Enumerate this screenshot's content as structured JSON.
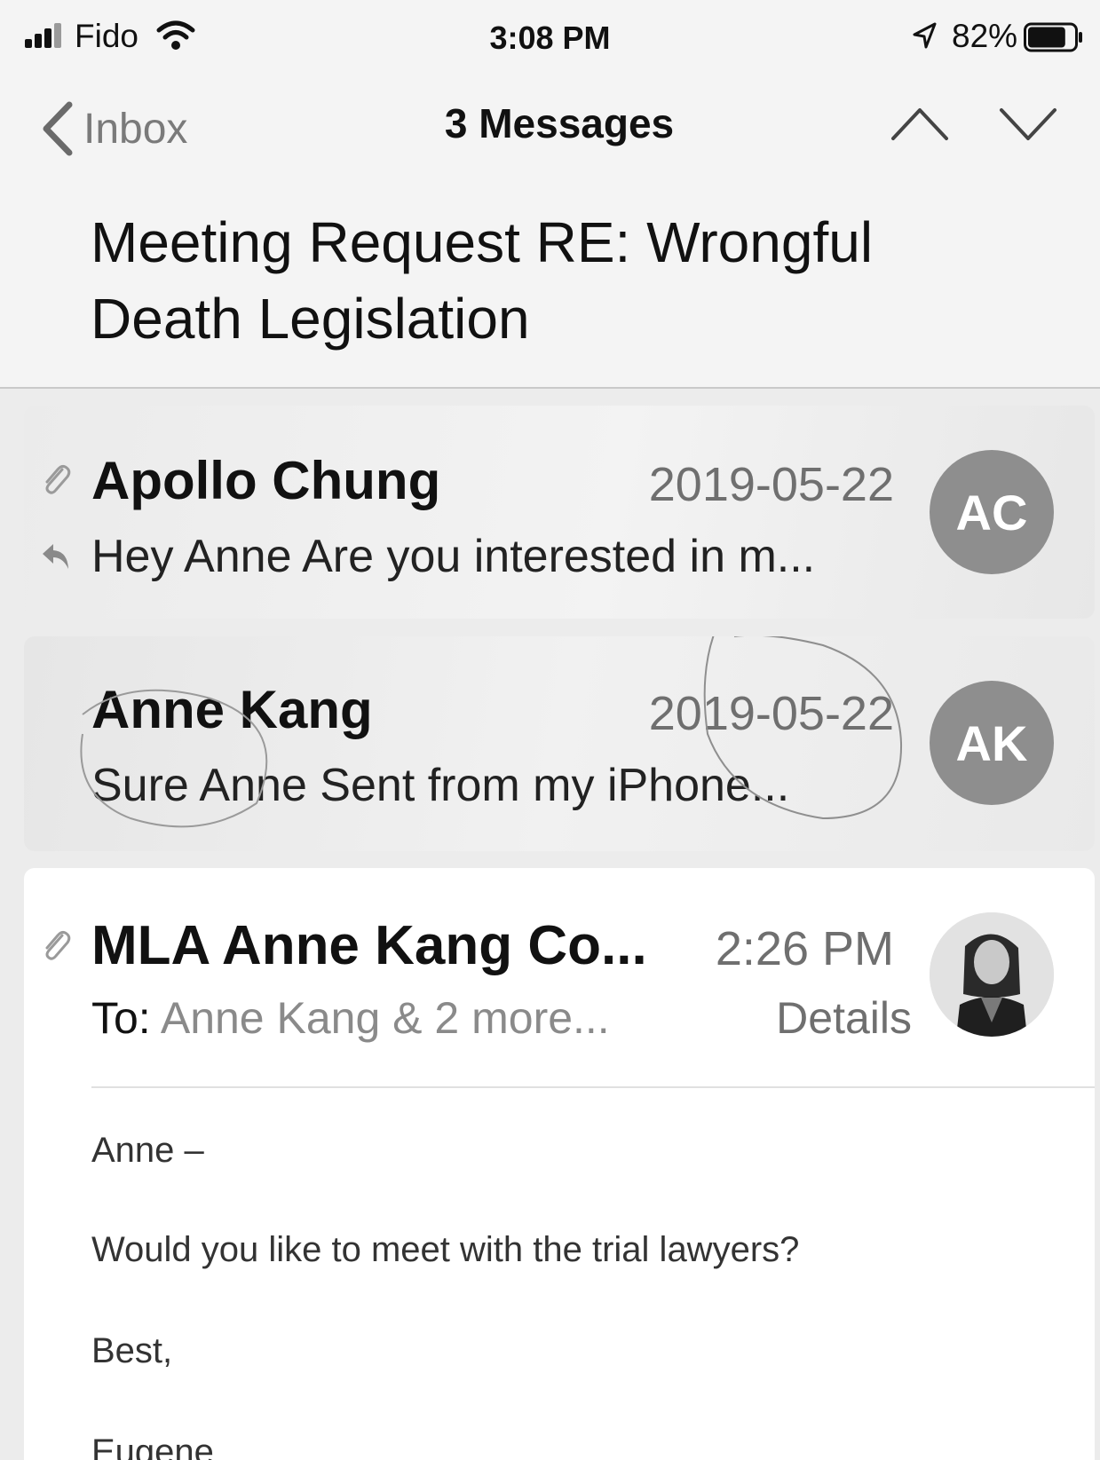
{
  "status_bar": {
    "carrier": "Fido",
    "time": "3:08 PM",
    "battery_percent": "82%",
    "battery_level": 0.82,
    "icons": [
      "signal-icon",
      "wifi-icon",
      "location-arrow-icon",
      "battery-icon"
    ]
  },
  "nav": {
    "back_label": "Inbox",
    "title": "3 Messages",
    "icons": [
      "back-chevron-icon",
      "chevron-up-icon",
      "chevron-down-icon"
    ]
  },
  "subject": "Meeting Request RE: Wrongful Death Legislation",
  "messages": [
    {
      "sender": "Apollo Chung",
      "date": "2019-05-22",
      "preview": "Hey Anne Are you interested in m...",
      "avatar_initials": "AC",
      "icons": [
        "paperclip-icon",
        "reply-icon"
      ]
    },
    {
      "sender": "Anne Kang",
      "date": "2019-05-22",
      "preview": "Sure Anne Sent from my iPhone...",
      "avatar_initials": "AK"
    },
    {
      "sender": "MLA Anne Kang Co...",
      "date": "2:26 PM",
      "to_label": "To:",
      "to_recipients": "Anne Kang & 2 more...",
      "details_label": "Details",
      "avatar": "photo-avatar",
      "icons": [
        "paperclip-icon"
      ],
      "body": {
        "greeting": "Anne –",
        "question": "Would you like to meet with the trial lawyers?",
        "closing": "Best,",
        "signature": "Eugene"
      }
    }
  ],
  "colors": {
    "background": "#ececec",
    "card": "#e9e9e9",
    "open_card": "#ffffff",
    "avatar": "#8e8e8e",
    "secondary_text": "#6f6f6f"
  }
}
